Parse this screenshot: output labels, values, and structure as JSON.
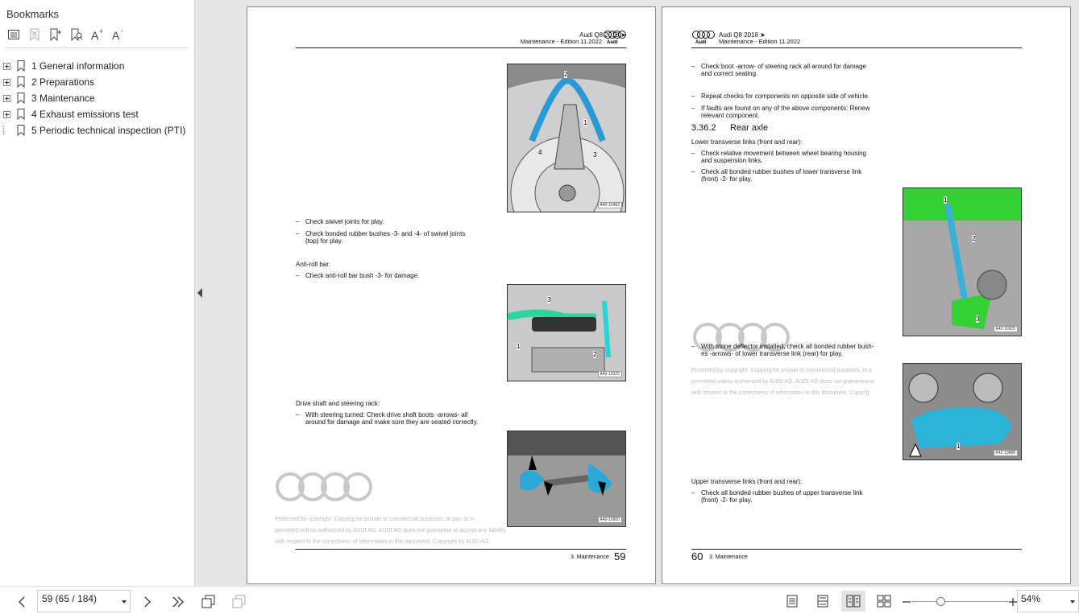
{
  "sidebar": {
    "title": "Bookmarks",
    "items": [
      {
        "label": "1 General information"
      },
      {
        "label": "2 Preparations"
      },
      {
        "label": "3 Maintenance"
      },
      {
        "label": "4 Exhaust emissions test"
      },
      {
        "label": "5 Periodic technical inspection (PTI)"
      }
    ]
  },
  "page_left": {
    "header_line1": "Audi Q8 2018 ➤",
    "header_line2": "Maintenance - Edition 11.2022",
    "brand": "Audi",
    "fig1_id": "A40-10482",
    "fig1_labels": [
      "2",
      "1",
      "3",
      "4"
    ],
    "bullet1": "Check swivel joints for play.",
    "bullet2_l1": "Check bonded rubber bushes -3- and -4- of swivel joints",
    "bullet2_l2": "(top) for play.",
    "section_antiroll": "Anti-roll bar:",
    "bullet3": "Check anti-roll bar bush -3- for damage.",
    "fig2_id": "A40-10325",
    "fig2_labels": [
      "3",
      "1",
      "2"
    ],
    "section_drive": "Drive shaft and steering rack:",
    "bullet4_l1": "With steering turned: Check drive shaft boots -arrows- all",
    "bullet4_l2": "around for damage and make sure they are seated correctly.",
    "fig3_id": "A40-10860",
    "copyright_l1": "Protected by copyright. Copying for private or commercial purposes, in part or in",
    "copyright_l2": "permitted unless authorised by AUDI AG. AUDI AG does not guarantee or accept any liability",
    "copyright_l3": "with respect to the correctness of information in this document. Copyright by AUDI AG.",
    "footer_chapter": "3. Maintenance",
    "page_number": "59"
  },
  "page_right": {
    "header_line1": "Audi Q8 2018 ➤",
    "header_line2": "Maintenance - Edition 11.2022",
    "brand": "Audi",
    "bullet1_l1": "Check boot -arrow- of steering rack all around for damage",
    "bullet1_l2": "and correct seating.",
    "bullet2": "Repeat checks for components on opposite side of vehicle.",
    "bullet3_l1": "If faults are found on any of the above components: Renew",
    "bullet3_l2": "relevant component.",
    "section_number": "3.36.2",
    "section_title": "Rear axle",
    "sub_lower": "Lower transverse links (front and rear):",
    "bullet4_l1": "Check relative movement between wheel bearing housing",
    "bullet4_l2": "and suspension links.",
    "bullet5_l1": "Check all bonded rubber bushes of lower transverse link",
    "bullet5_l2": "(front) -2- for play.",
    "fig1_id": "A42-10625",
    "fig1_labels": [
      "1",
      "2",
      "3"
    ],
    "bullet6_l1": "With stone deflector installed, check all bonded rubber bush-",
    "bullet6_l2": "es -arrows- of lower transverse link (rear) for play.",
    "copyright_l1": "Protected by copyright. Copying for private or commercial purposes, in p",
    "copyright_l2": "permitted unless authorised by AUDI AG. AUDI AG does not guarantee or",
    "copyright_l3": "with respect to the correctness of information in this document. Copyrig",
    "fig2_id": "A42-10888",
    "fig2_labels": [
      "1"
    ],
    "sub_upper": "Upper transverse links (front and rear):",
    "bullet7_l1": "Check all bonded rubber bushes of upper transverse link",
    "bullet7_l2": "(front) -2- for play.",
    "page_number": "60",
    "footer_chapter": "3. Maintenance"
  },
  "statusbar": {
    "page_indicator": "59 (65 / 184)",
    "zoom": "54%",
    "zoom_fraction": 0.3
  }
}
